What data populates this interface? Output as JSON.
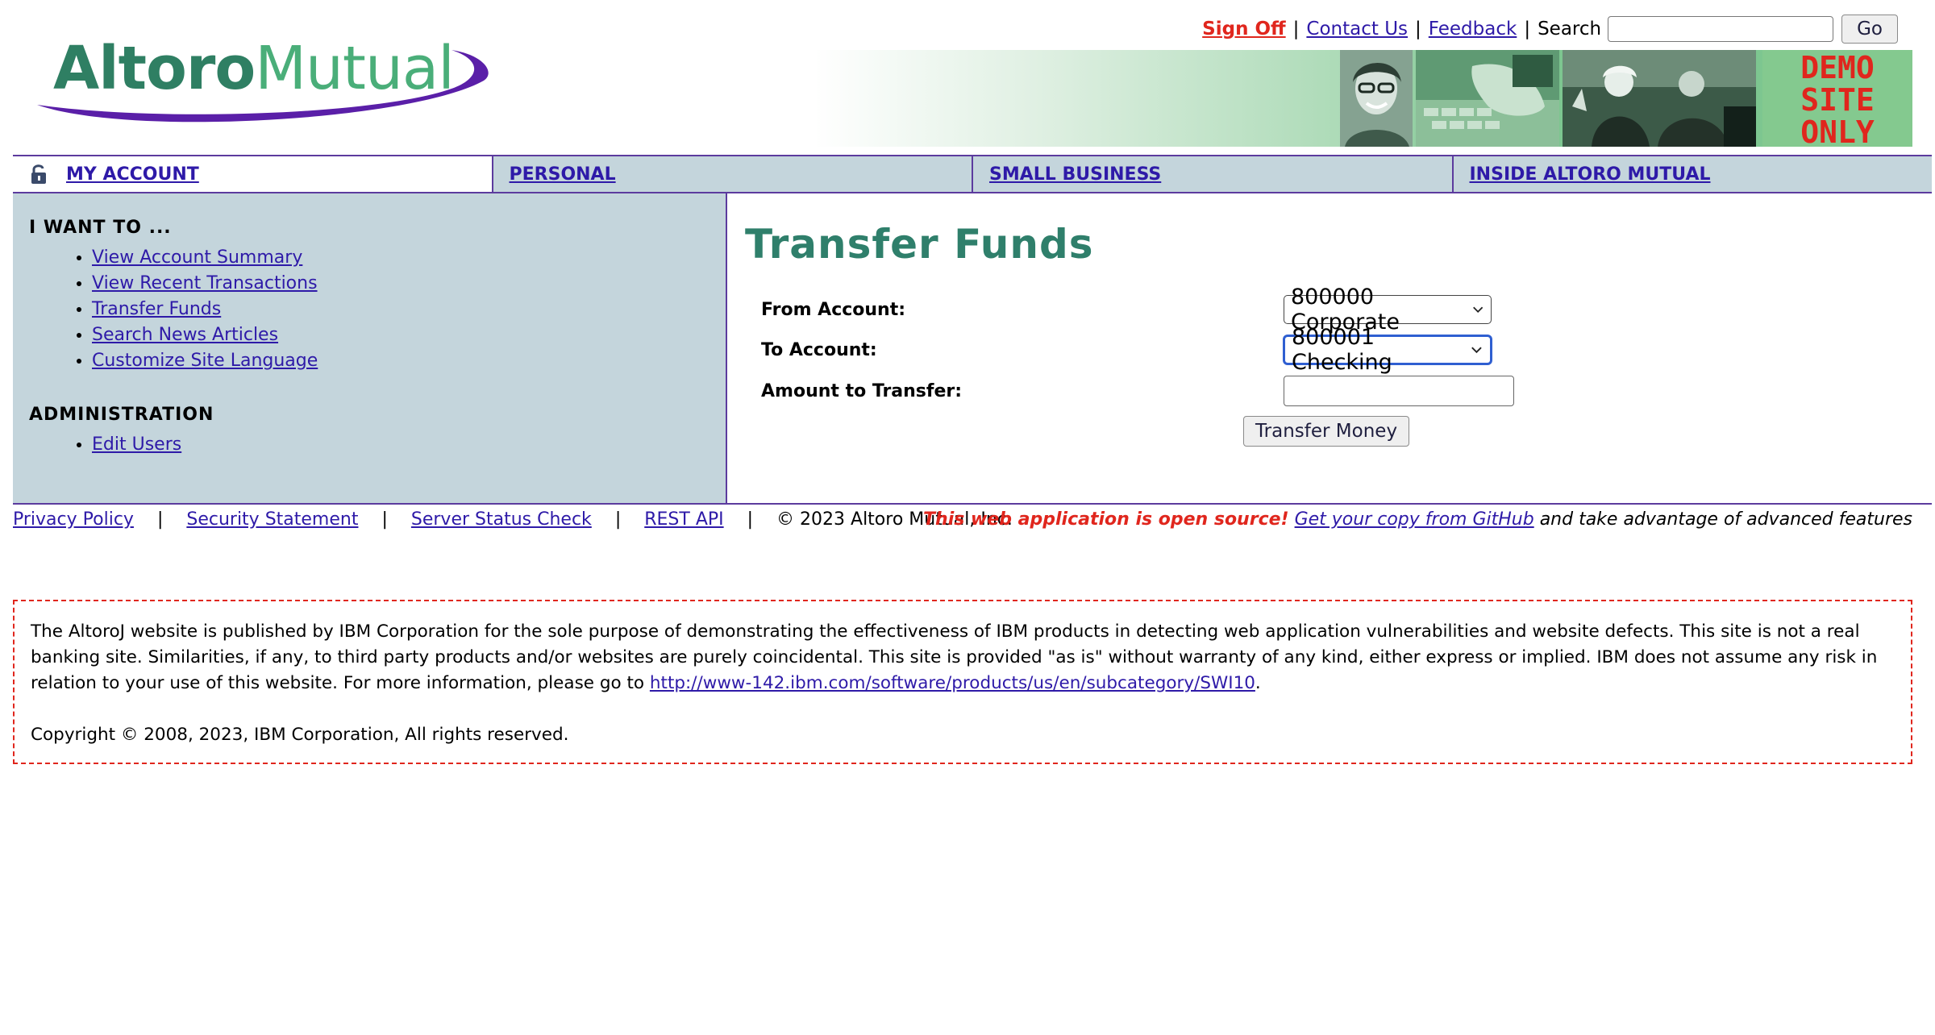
{
  "logo": {
    "altoro": "Altoro",
    "mutual": "Mutual"
  },
  "toplinks": {
    "sign_off": "Sign Off",
    "contact_us": "Contact Us",
    "feedback": "Feedback",
    "separator": "|",
    "search_label": "Search",
    "search_value": "",
    "go_label": "Go"
  },
  "banner": {
    "demo_line1": "DEMO",
    "demo_line2": "SITE",
    "demo_line3": "ONLY"
  },
  "nav": {
    "tabs": [
      {
        "label": "MY ACCOUNT",
        "active": true
      },
      {
        "label": "PERSONAL",
        "active": false
      },
      {
        "label": "SMALL BUSINESS",
        "active": false
      },
      {
        "label": "INSIDE ALTORO MUTUAL",
        "active": false
      }
    ]
  },
  "sidebar": {
    "heading": "I WANT TO ...",
    "items": [
      {
        "label": "View Account Summary"
      },
      {
        "label": "View Recent Transactions"
      },
      {
        "label": "Transfer Funds"
      },
      {
        "label": "Search News Articles"
      },
      {
        "label": "Customize Site Language"
      }
    ],
    "admin_heading": "ADMINISTRATION",
    "admin_items": [
      {
        "label": "Edit Users"
      }
    ]
  },
  "main": {
    "title": "Transfer Funds",
    "from_label": "From Account:",
    "from_value": "800000 Corporate",
    "to_label": "To Account:",
    "to_value": "800001 Checking",
    "amount_label": "Amount to Transfer:",
    "amount_value": "",
    "submit_label": "Transfer Money"
  },
  "footer": {
    "privacy": "Privacy Policy",
    "security": "Security Statement",
    "server_status": "Server Status Check",
    "rest_api": "REST API",
    "separator": "|",
    "copyright": "© 2023 Altoro Mutual, Inc.",
    "oss_notice": "This web application is open source!",
    "github_link": "Get your copy from GitHub",
    "oss_tail": "and take advantage of advanced features"
  },
  "disclaimer": {
    "text_before_link": "The AltoroJ website is published by IBM Corporation for the sole purpose of demonstrating the effectiveness of IBM products in detecting web application vulnerabilities and website defects. This site is not a real banking site. Similarities, if any, to third party products and/or websites are purely coincidental. This site is provided \"as is\" without warranty of any kind, either express or implied. IBM does not assume any risk in relation to your use of this website. For more information, please go to ",
    "link": "http://www-142.ibm.com/software/products/us/en/subcategory/SWI10",
    "text_after_link": ".",
    "copyright": "Copyright © 2008, 2023, IBM Corporation, All rights reserved."
  },
  "colors": {
    "brand_green": "#2f7f63",
    "accent_purple": "#5c3b9e",
    "nav_bg": "#c4d5dc",
    "alert_red": "#e0261d",
    "link_blue": "#2e1aa8"
  },
  "icons": {
    "nav_lock": "lock-icon",
    "select_chevron": "chevron-down-icon"
  }
}
